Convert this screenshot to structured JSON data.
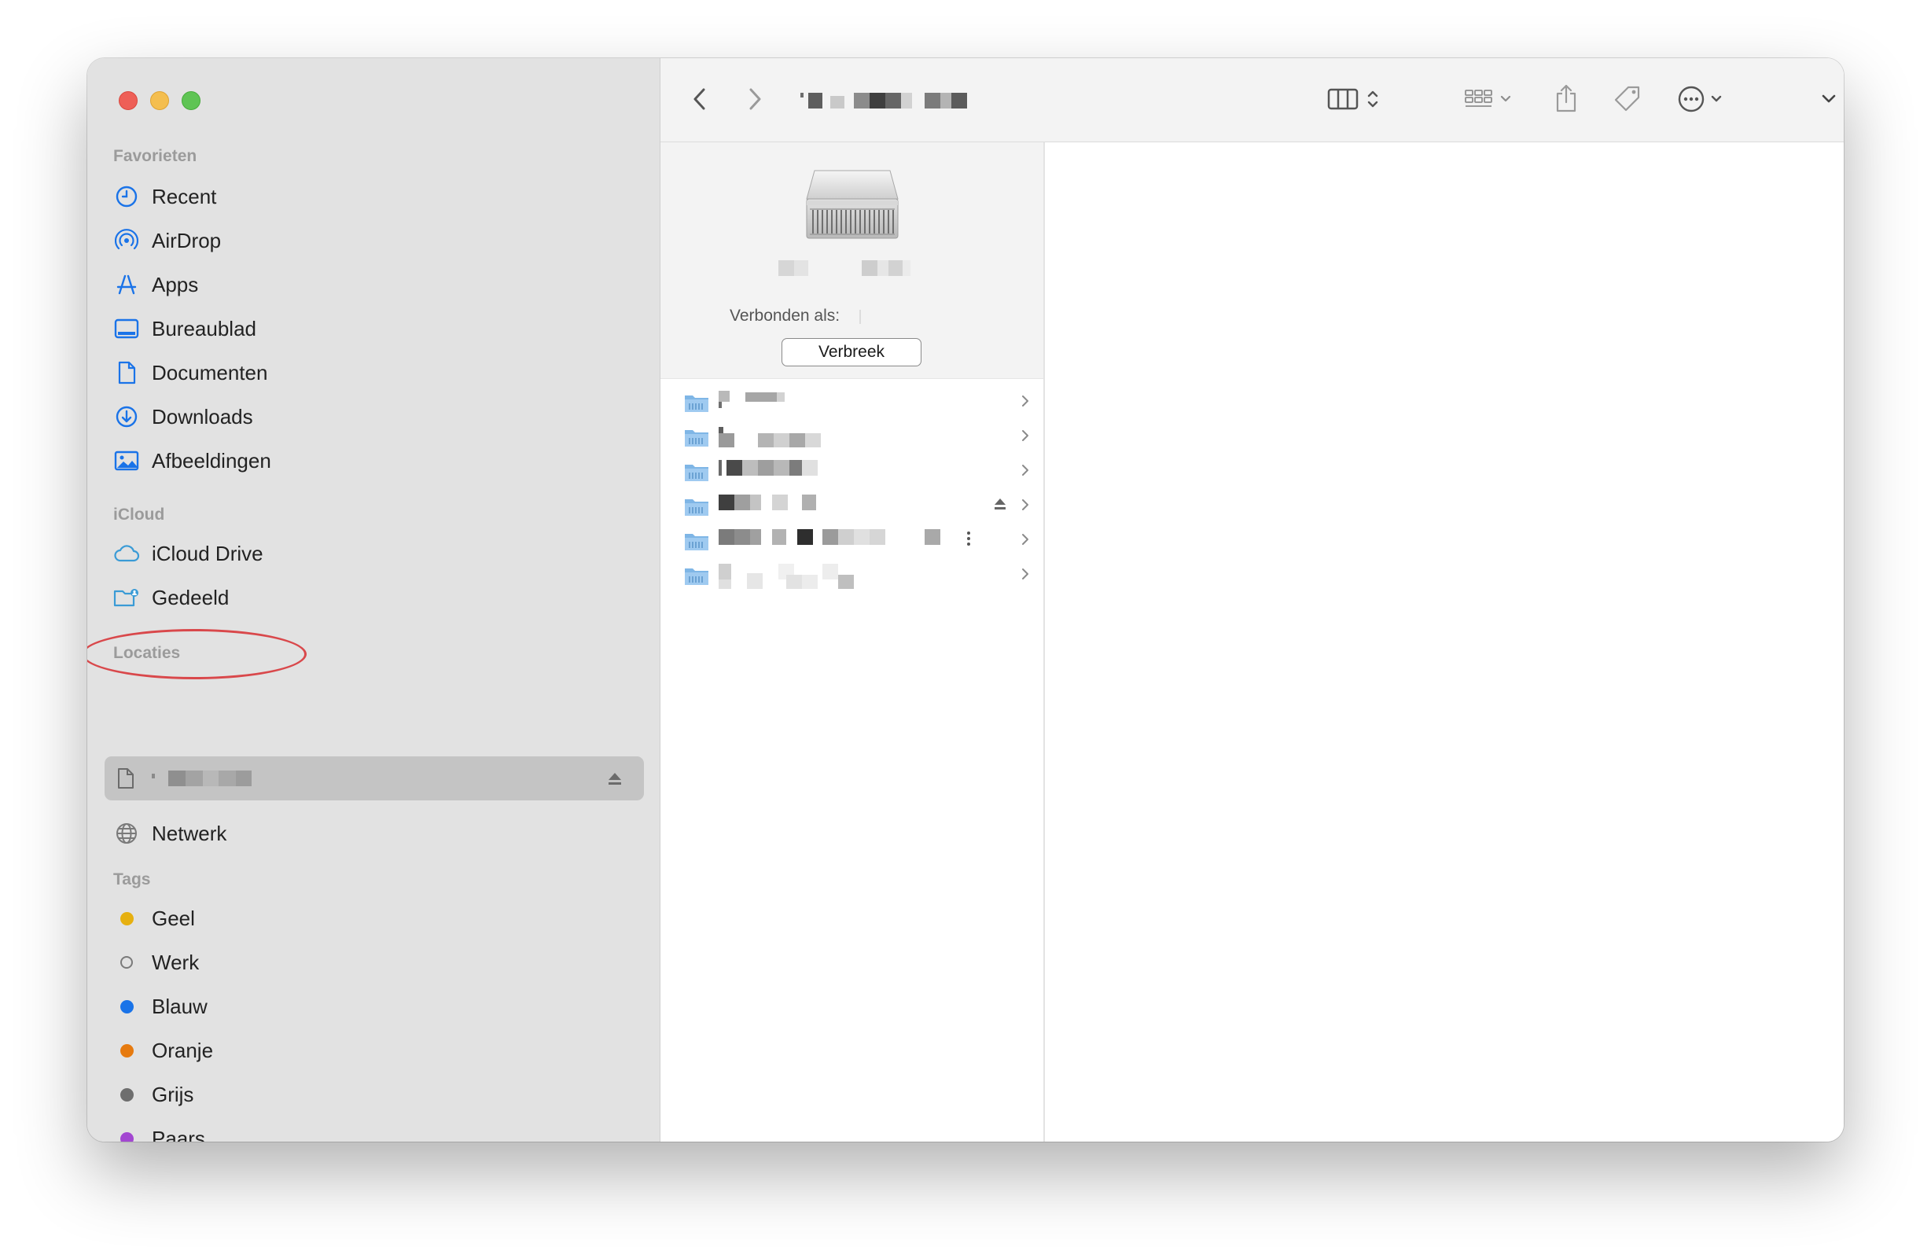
{
  "sidebar": {
    "sections": {
      "favorites": "Favorieten",
      "icloud": "iCloud",
      "locations": "Locaties",
      "tags": "Tags"
    },
    "favorites": [
      {
        "label": "Recent",
        "icon": "clock-icon"
      },
      {
        "label": "AirDrop",
        "icon": "airdrop-icon"
      },
      {
        "label": "Apps",
        "icon": "apps-icon"
      },
      {
        "label": "Bureaublad",
        "icon": "desktop-icon"
      },
      {
        "label": "Documenten",
        "icon": "document-icon"
      },
      {
        "label": "Downloads",
        "icon": "download-icon"
      },
      {
        "label": "Afbeeldingen",
        "icon": "pictures-icon"
      }
    ],
    "icloud": [
      {
        "label": "iCloud Drive",
        "icon": "cloud-icon"
      },
      {
        "label": "Gedeeld",
        "icon": "shared-folder-icon"
      }
    ],
    "locations": [
      {
        "label": "",
        "icon": "document-icon",
        "selected": true,
        "ejectable": true
      },
      {
        "label": "Netwerk",
        "icon": "globe-icon"
      }
    ],
    "tags": [
      {
        "label": "Geel",
        "color": "#e6b010"
      },
      {
        "label": "Werk",
        "color": "none"
      },
      {
        "label": "Blauw",
        "color": "#1a73e8"
      },
      {
        "label": "Oranje",
        "color": "#e67a0f"
      },
      {
        "label": "Grijs",
        "color": "#6e6e6e"
      },
      {
        "label": "Paars",
        "color": "#a347d1"
      }
    ]
  },
  "server_panel": {
    "connected_label": "Verbonden als:",
    "disconnect_button": "Verbreek"
  },
  "colors": {
    "accent": "#1a73e8",
    "annotation_circle": "#d9484b"
  }
}
